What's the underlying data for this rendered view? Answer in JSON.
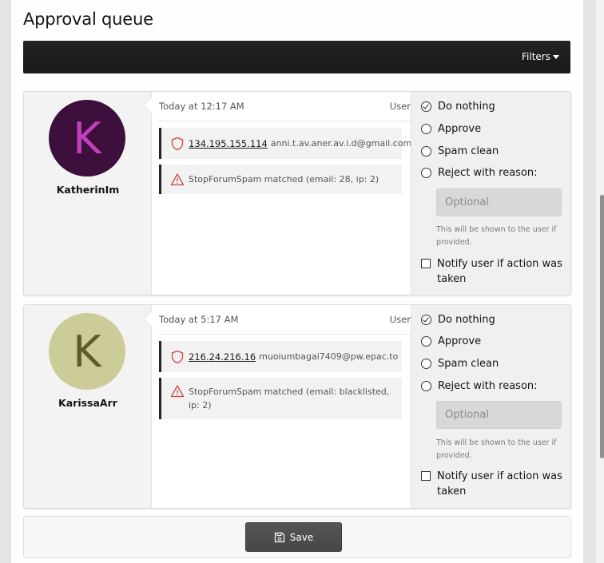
{
  "page": {
    "title": "Approval queue"
  },
  "toolbar": {
    "filters_label": "Filters"
  },
  "items": [
    {
      "avatar_letter": "K",
      "avatar_bg": "#3d0f3d",
      "avatar_fg": "#c040c0",
      "username": "KatherinIm",
      "time": "Today at 12:17 AM",
      "type": "User",
      "ip": "134.195.155.114",
      "email": "anni.t.av.aner.av.i.d@gmail.com",
      "spam_message": "StopForumSpam matched (email: 28, ip: 2)",
      "actions": {
        "do_nothing": "Do nothing",
        "approve": "Approve",
        "spam_clean": "Spam clean",
        "reject": "Reject with reason:",
        "reason_placeholder": "Optional",
        "hint": "This will be shown to the user if provided.",
        "notify": "Notify user if action was taken"
      }
    },
    {
      "avatar_letter": "K",
      "avatar_bg": "#cccc99",
      "avatar_fg": "#5c5c24",
      "username": "KarissaArr",
      "time": "Today at 5:17 AM",
      "type": "User",
      "ip": "216.24.216.16",
      "email": "muoiumbagai7409@pw.epac.to",
      "spam_message": "StopForumSpam matched (email: blacklisted, ip: 2)",
      "actions": {
        "do_nothing": "Do nothing",
        "approve": "Approve",
        "spam_clean": "Spam clean",
        "reject": "Reject with reason:",
        "reason_placeholder": "Optional",
        "hint": "This will be shown to the user if provided.",
        "notify": "Notify user if action was taken"
      }
    }
  ],
  "footer": {
    "save_label": "Save"
  },
  "icons": {
    "shield": "shield-icon",
    "warning": "warning-triangle-icon",
    "save": "save-icon",
    "filters_caret": "caret-down-icon"
  },
  "colors": {
    "alert_red": "#d04545"
  }
}
